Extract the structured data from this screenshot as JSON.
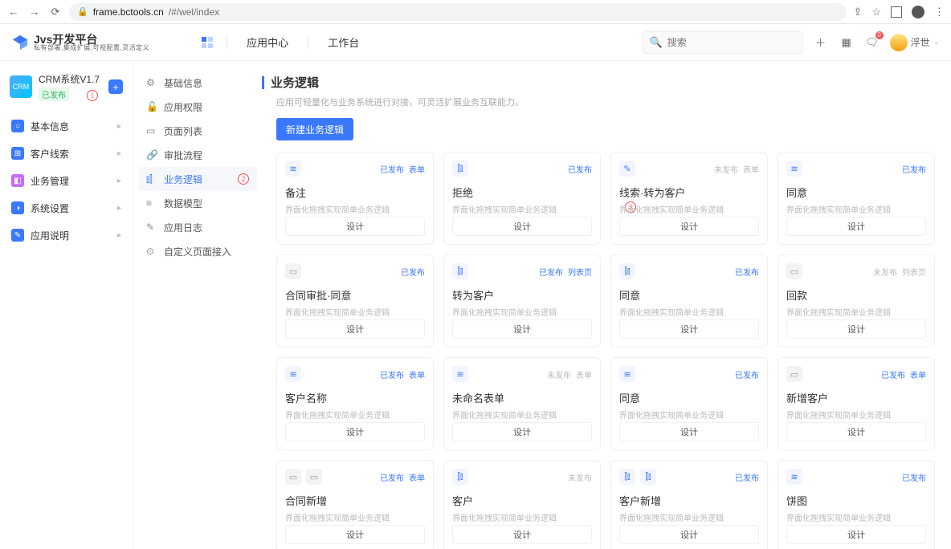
{
  "chrome": {
    "url_domain": "frame.bctools.cn",
    "url_path": "/#/wel/index"
  },
  "topbar": {
    "brand_main": "Jvs开发平台",
    "brand_sub": "私有部署,集成扩展,可视配置,灵活定义",
    "nav1": "应用中心",
    "nav2": "工作台",
    "search_placeholder": "搜索",
    "user": "浮世"
  },
  "sidebar1": {
    "app_name": "CRM系统V1.7",
    "app_status": "已发布",
    "items": [
      {
        "label": "基本信息",
        "color": "#3a78ff",
        "ico": "○"
      },
      {
        "label": "客户线索",
        "color": "#3a78ff",
        "ico": "⊞"
      },
      {
        "label": "业务管理",
        "color": "#c66cff",
        "ico": "◧"
      },
      {
        "label": "系统设置",
        "color": "#3a78ff",
        "ico": "◑"
      },
      {
        "label": "应用说明",
        "color": "#3a78ff",
        "ico": "✎"
      }
    ]
  },
  "sidebar2": {
    "items": [
      {
        "label": "基础信息",
        "icon": "gear"
      },
      {
        "label": "应用权限",
        "icon": "lock"
      },
      {
        "label": "页面列表",
        "icon": "doc"
      },
      {
        "label": "审批流程",
        "icon": "link"
      },
      {
        "label": "业务逻辑",
        "icon": "logic",
        "active": true
      },
      {
        "label": "数据模型",
        "icon": "stack"
      },
      {
        "label": "应用日志",
        "icon": "log"
      },
      {
        "label": "自定义页面接入",
        "icon": "custom"
      }
    ]
  },
  "content": {
    "title": "业务逻辑",
    "subtitle": "应用可轻量化与业务系统进行对接，可灵活扩展业务互联能力。",
    "new_button": "新建业务逻辑",
    "card_desc": "界面化拖拽实现简单业务逻辑",
    "card_btn": "设计"
  },
  "cards": [
    {
      "title": "备注",
      "tags": [
        "已发布",
        "表单"
      ],
      "icons": [
        "layers"
      ],
      "iconStyle": "blue"
    },
    {
      "title": "拒绝",
      "tags": [
        "已发布"
      ],
      "icons": [
        "sliders"
      ],
      "iconStyle": "blue"
    },
    {
      "title": "线索·转为客户",
      "tags": [
        "未发布",
        "表单"
      ],
      "tagStyle": [
        "muted",
        "muted"
      ],
      "icons": [
        "pen"
      ],
      "iconStyle": "blue"
    },
    {
      "title": "同意",
      "tags": [
        "已发布"
      ],
      "icons": [
        "layers"
      ],
      "iconStyle": "blue"
    },
    {
      "title": "合同审批·同意",
      "tags": [
        "已发布"
      ],
      "icons": [
        "doc"
      ],
      "iconStyle": "gray"
    },
    {
      "title": "转为客户",
      "tags": [
        "已发布",
        "列表页"
      ],
      "icons": [
        "sliders"
      ],
      "iconStyle": "blue"
    },
    {
      "title": "同意",
      "tags": [
        "已发布"
      ],
      "icons": [
        "sliders"
      ],
      "iconStyle": "blue"
    },
    {
      "title": "回款",
      "tags": [
        "未发布",
        "列表页"
      ],
      "tagStyle": [
        "muted",
        "muted"
      ],
      "icons": [
        "doc"
      ],
      "iconStyle": "gray"
    },
    {
      "title": "客户名称",
      "tags": [
        "已发布",
        "表单"
      ],
      "icons": [
        "layers"
      ],
      "iconStyle": "blue"
    },
    {
      "title": "未命名表单",
      "tags": [
        "未发布",
        "表单"
      ],
      "tagStyle": [
        "muted",
        "muted"
      ],
      "icons": [
        "layers"
      ],
      "iconStyle": "blue"
    },
    {
      "title": "同意",
      "tags": [
        "已发布"
      ],
      "icons": [
        "layers"
      ],
      "iconStyle": "blue"
    },
    {
      "title": "新增客户",
      "tags": [
        "已发布",
        "表单"
      ],
      "icons": [
        "doc"
      ],
      "iconStyle": "gray"
    },
    {
      "title": "合同新增",
      "tags": [
        "已发布",
        "表单"
      ],
      "icons": [
        "doc",
        "doc"
      ],
      "iconStyle": "gray"
    },
    {
      "title": "客户",
      "tags": [
        "未发布"
      ],
      "tagStyle": [
        "muted"
      ],
      "icons": [
        "sliders"
      ],
      "iconStyle": "blue"
    },
    {
      "title": "客户新增",
      "tags": [
        "已发布"
      ],
      "icons": [
        "sliders",
        "sliders"
      ],
      "iconStyle": "blue"
    },
    {
      "title": "饼图",
      "tags": [
        "已发布"
      ],
      "icons": [
        "layers"
      ],
      "iconStyle": "blue"
    }
  ],
  "markers": {
    "m1": "1",
    "m2": "2",
    "m3": "3"
  }
}
